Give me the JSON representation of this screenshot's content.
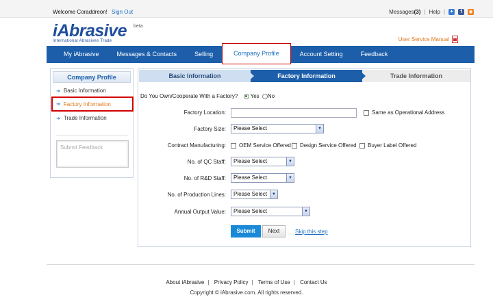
{
  "topbar": {
    "welcome": "Welcome Coraddreon!",
    "signout": "Sign Out",
    "messages_label": "Messages",
    "messages_count": "(3)",
    "help": "Help"
  },
  "logo": {
    "name": "iAbrasive",
    "beta": "beta",
    "tagline": "International Abrasives Trade"
  },
  "user_manual": "User Service Manual",
  "nav": [
    {
      "label": "My iAbrasive"
    },
    {
      "label": "Messages & Contacts"
    },
    {
      "label": "Selling"
    },
    {
      "label": "Company Profile"
    },
    {
      "label": "Account Setting"
    },
    {
      "label": "Feedback"
    }
  ],
  "sidebar": {
    "title": "Company Profile",
    "items": [
      {
        "label": "Basic Information"
      },
      {
        "label": "Factory Information"
      },
      {
        "label": "Trade Information"
      }
    ],
    "feedback_placeholder": "Submit Feedback"
  },
  "steps": [
    "Basic Information",
    "Factory Information",
    "Trade Information"
  ],
  "form": {
    "own_factory_label": "Do You Own/Cooperate With a Factory?",
    "own_factory_yes": "Yes",
    "own_factory_no": "No",
    "factory_location_label": "Factory Location:",
    "factory_location_value": "",
    "same_as_operational": "Same as Operational Address",
    "factory_size_label": "Factory Size:",
    "factory_size_value": "Please Select",
    "contract_mfg_label": "Contract Manufacturing:",
    "contract_options": [
      "OEM Service Offered",
      "Design Service Offered",
      "Buyer Label Offered"
    ],
    "qc_staff_label": "No. of QC Staff:",
    "qc_staff_value": "Please Select",
    "rd_staff_label": "No. of R&D Staff:",
    "rd_staff_value": "Please Select",
    "prod_lines_label": "No. of Production Lines:",
    "prod_lines_value": "Please Select",
    "output_value_label": "Annual Output Value:",
    "output_value_value": "Please Select",
    "submit": "Submit",
    "next": "Next",
    "skip": "Skip this step"
  },
  "footer": {
    "links": [
      "About iAbrasive",
      "Privacy Policy",
      "Terms of Use",
      "Contact Us"
    ],
    "copyright": "Copyright © iAbrasive.com. All rights reserved."
  },
  "colors": {
    "nav_blue": "#1c5eaa",
    "link_blue": "#1a6fc0",
    "accent_orange": "#e07a1f",
    "highlight_red": "#d40000",
    "submit_blue": "#1a8ad8"
  }
}
